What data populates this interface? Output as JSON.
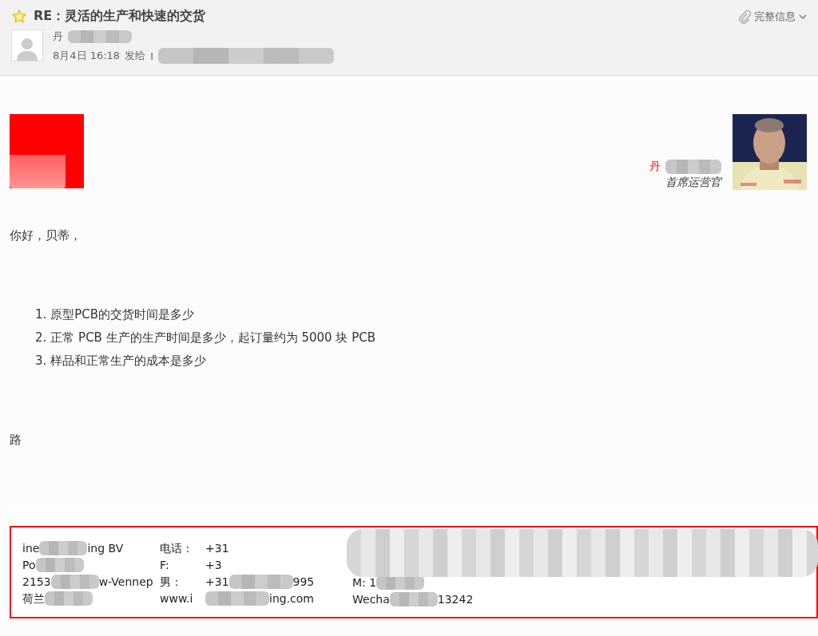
{
  "header": {
    "title": "RE：灵活的生产和快速的交货",
    "details_link": "完整信息",
    "sender": "丹",
    "date": "8月4日 16:18",
    "sent_to_label": "发给",
    "recipient": "I"
  },
  "letterhead": {
    "name": "丹",
    "job_title": "首席运营官"
  },
  "greeting": "你好，贝蒂，",
  "questions": [
    {
      "number": "1.",
      "text": "原型PCB的交货时间是多少"
    },
    {
      "number": "2.",
      "text": "正常 PCB 生产的生产时间是多少，起订量约为 5000 块 PCB"
    },
    {
      "number": "3.",
      "text": "样品和正常生产的成本是多少"
    }
  ],
  "closing": "路",
  "signature": {
    "columns": [
      [
        [
          "ine",
          "ing BV"
        ],
        [
          "Po"
        ],
        [
          "2153 ",
          "w-Vennep"
        ],
        [
          "荷兰"
        ]
      ],
      [
        [
          "电话：",
          "+31"
        ],
        [
          "F:",
          "+3"
        ],
        [
          "男：",
          "+31",
          "995"
        ],
        [
          "www.i",
          "ing.com"
        ]
      ],
      [
        [
          "M: 1"
        ],
        [
          "Wecha",
          "13242"
        ]
      ]
    ]
  }
}
